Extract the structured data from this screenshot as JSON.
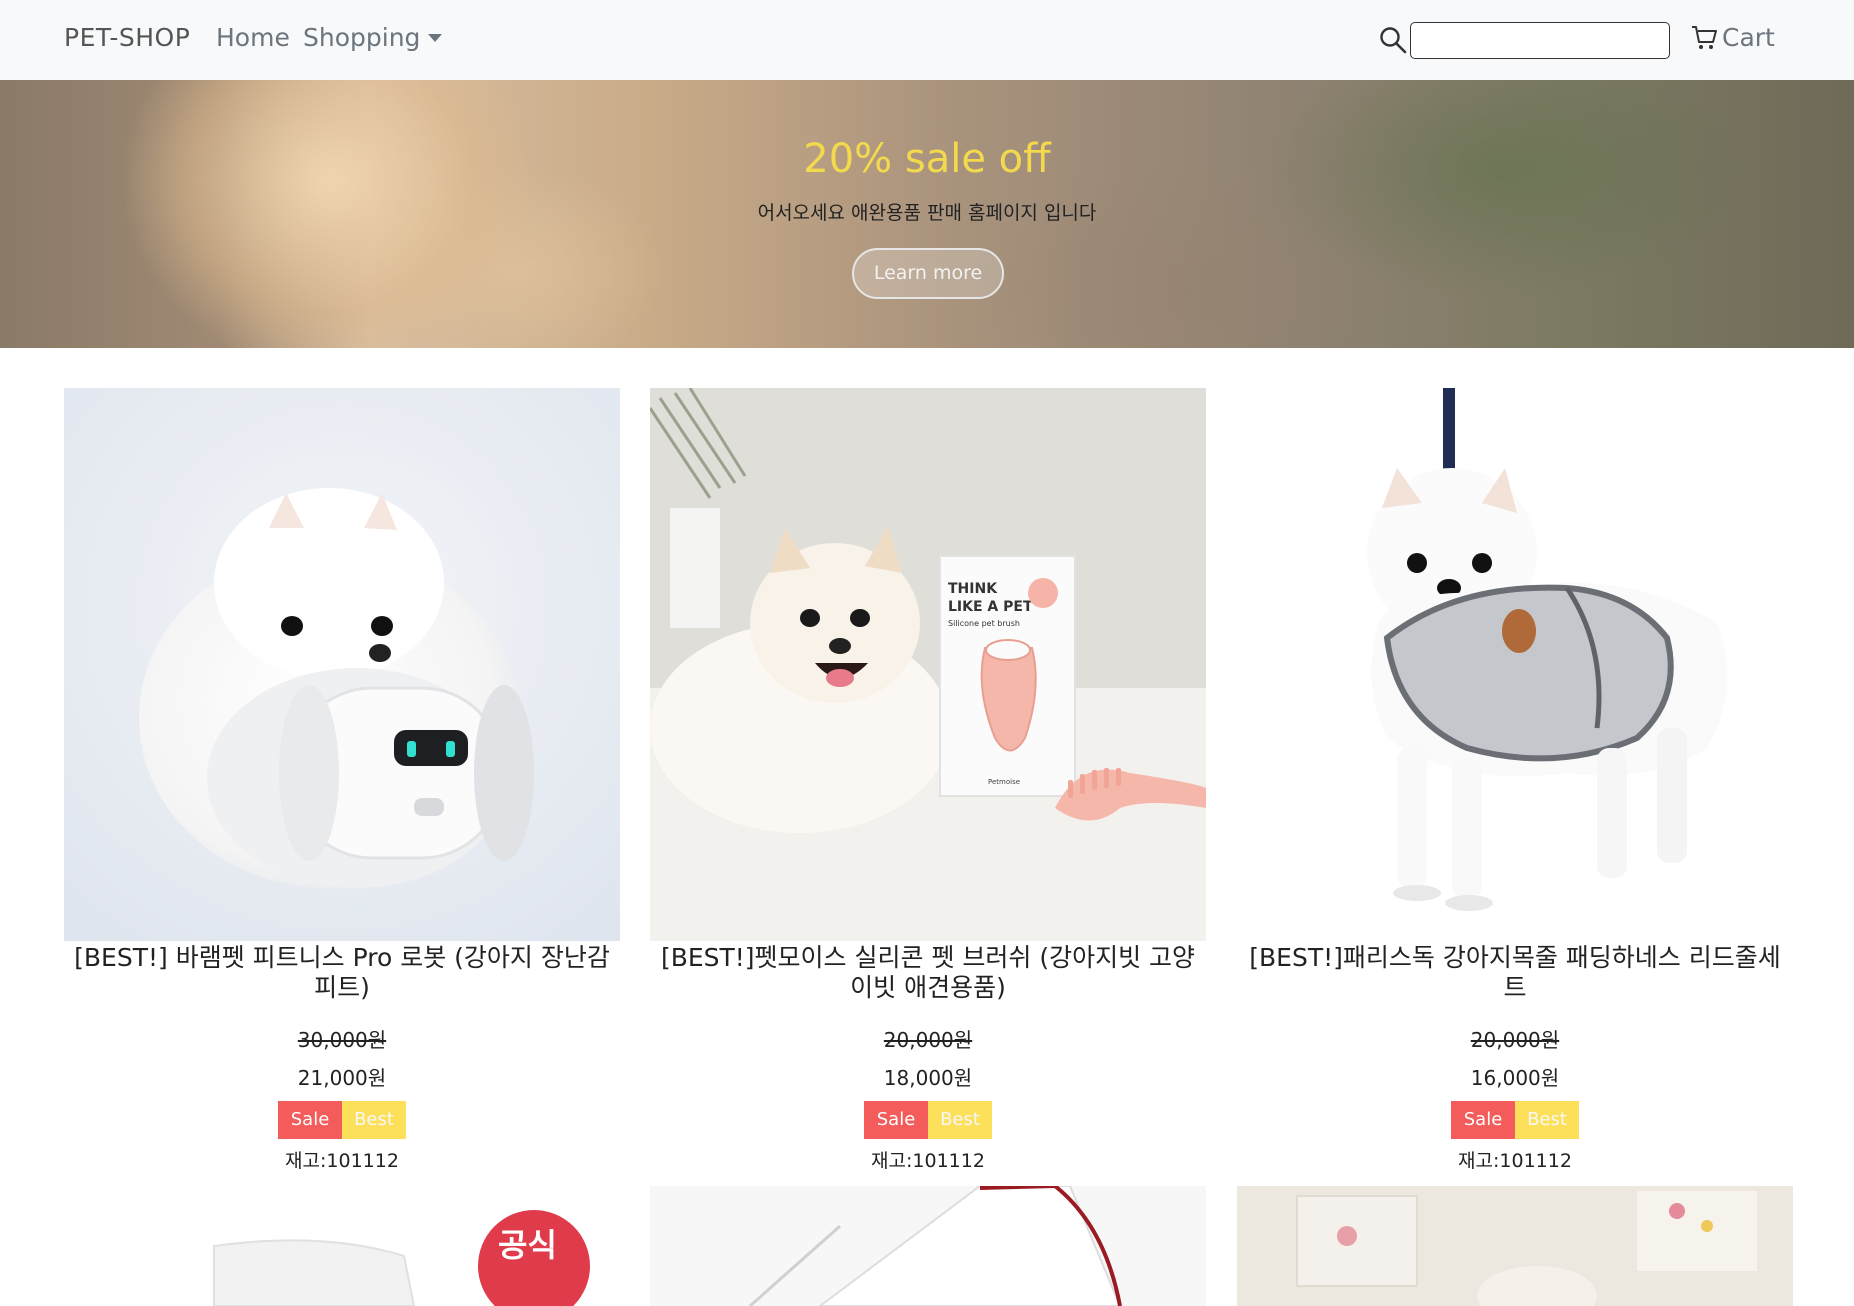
{
  "navbar": {
    "brand": "PET-SHOP",
    "home_label": "Home",
    "shopping_label": "Shopping",
    "search_value": "",
    "cart_label": "Cart"
  },
  "hero": {
    "title": "20% sale off",
    "subtitle": "어서오세요 애완용품 판매 홈페이지 입니다",
    "button_label": "Learn more"
  },
  "products": [
    {
      "title": "[BEST!] 바램펫 피트니스 Pro 로봇 (강아지 장난감 피트)",
      "original_price": "30,000원",
      "sale_price": "21,000원",
      "badge_sale": "Sale",
      "badge_best": "Best",
      "stock": "재고:101112"
    },
    {
      "title": "[BEST!]펫모이스 실리콘 펫 브러쉬 (강아지빗 고양이빗 애견용품)",
      "original_price": "20,000원",
      "sale_price": "18,000원",
      "badge_sale": "Sale",
      "badge_best": "Best",
      "stock": "재고:101112"
    },
    {
      "title": "[BEST!]패리스독 강아지목줄 패딩하네스 리드줄세트",
      "original_price": "20,000원",
      "sale_price": "16,000원",
      "badge_sale": "Sale",
      "badge_best": "Best",
      "stock": "재고:101112"
    }
  ],
  "product_images": {
    "p2_box_line1": "THINK",
    "p2_box_line2": "LIKE A PET",
    "p2_box_line3": "Silicone pet brush",
    "p2_box_brand": "Petmoise",
    "p4_badge": "공식"
  },
  "colors": {
    "navbar_bg": "#f8f9fa",
    "hero_title": "#f3d94c",
    "badge_sale": "#f45b5b",
    "badge_best": "#fde05a"
  }
}
